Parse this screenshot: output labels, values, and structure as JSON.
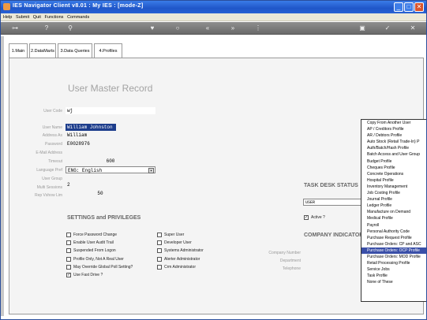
{
  "window": {
    "title": "IES Navigator Client v8.01 : My IES :      [mode-Z]",
    "minimize": "_",
    "maximize": "□",
    "close": "✕"
  },
  "menu": [
    "Help",
    "Submit",
    "Quit",
    "Functions",
    "Commands"
  ],
  "toolbar_icons": [
    "key-icon",
    "help-icon",
    "search-icon",
    "heart-icon",
    "circle-icon",
    "rewind-icon",
    "fast-forward-icon",
    "tree-icon",
    "save-icon",
    "check-icon",
    "close-icon"
  ],
  "tabs": [
    "1.Main",
    "2.DataMarts",
    "3.Data Queries",
    "4.Profiles"
  ],
  "title": "User Master Record",
  "fields": {
    "user_code_label": "User Code",
    "user_code": "wj",
    "user_name_label": "User Name",
    "user_name": "William Johnston",
    "address_as_label": "Address As",
    "address_as": "William",
    "password_label": "Password",
    "password": "E0028976",
    "email_label": "E-Mail Address",
    "email": "",
    "timeout_label": "Timeout",
    "timeout": "600",
    "language_label": "Language Pref",
    "language": "ENG: English",
    "user_group_label": "User Group",
    "user_group": "",
    "multi_sessions_label": "Multi Sessions",
    "multi_sessions": "2",
    "rep_vshow_label": "Rep Vshow Lim",
    "rep_vshow": "50"
  },
  "settings": {
    "title": "SETTINGS and PRIVILEGES",
    "left": [
      {
        "label": "Force Password Change",
        "checked": false
      },
      {
        "label": "Enable User Audit Trail",
        "checked": false
      },
      {
        "label": "Suspended From Logon",
        "checked": false
      },
      {
        "label": "Profile Only, Not A Real User",
        "checked": false
      },
      {
        "label": "May Override Global Poll Setting?",
        "checked": false
      },
      {
        "label": "Use Fast Drive ?",
        "checked": true
      }
    ],
    "right": [
      {
        "label": "Super User",
        "checked": false
      },
      {
        "label": "Developer User",
        "checked": false
      },
      {
        "label": "Systems Administrator",
        "checked": false
      },
      {
        "label": "Alerter Administrator",
        "checked": false
      },
      {
        "label": "Crm Administrator",
        "checked": false
      }
    ]
  },
  "task_desk": {
    "title": "TASK DESK STATUS",
    "value": "USER",
    "active_label": "Active ?",
    "active_checked": true
  },
  "company": {
    "title": "COMPANY INDICATOR",
    "company_number_label": "Company Number",
    "department_label": "Department",
    "telephone_label": "Telephone"
  },
  "dropdown": {
    "items": [
      "Copy From Another User",
      "AP / Creditors Profile",
      "AR / Debtors Profile",
      "Auto Stock (Retail Trade-In) P",
      "Auth/Batch/Hash Profile",
      "Batch Access and User Group",
      "Budget Profile",
      "Cheques Profile",
      "Concrete Operations",
      "Hospital Profile",
      "Inventory Management",
      "Job Costing Profile",
      "Journal Profile",
      "Ledger Profile",
      "Manufacture on Demand",
      "Medical Profile",
      "Payroll",
      "Personal Authority Code",
      "Purchase Request Profile",
      "Purchase Orders: CP and ASC",
      "Purchase Orders: OCP Profile",
      "Purchase Orders: MOD Profile",
      "Retail Processing Profile",
      "Service Jobs",
      "Task Profile",
      "None of These"
    ],
    "selected_index": 20
  }
}
